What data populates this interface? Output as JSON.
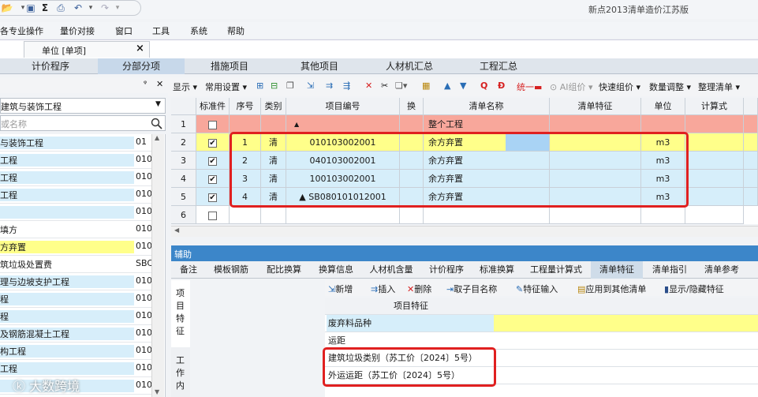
{
  "app": {
    "title": "新点2013清单造价江苏版"
  },
  "menu": [
    "各专业操作",
    "量价对接",
    "窗口",
    "工具",
    "系统",
    "帮助"
  ],
  "doc_tab": {
    "label": "单位 [单项]",
    "close": "×"
  },
  "ribbon_tabs": [
    {
      "label": "计价程序",
      "active": false
    },
    {
      "label": "分部分项",
      "active": true
    },
    {
      "label": "措施项目",
      "active": false
    },
    {
      "label": "其他项目",
      "active": false
    },
    {
      "label": "人材机汇总",
      "active": false
    },
    {
      "label": "工程汇总",
      "active": false
    }
  ],
  "sidebar": {
    "pin": "ᵠ",
    "close": "✕",
    "combo": "建筑与装饰工程",
    "search_placeholder": "或名称",
    "items": [
      {
        "name": "与装饰工程",
        "code": "01",
        "style": "blue"
      },
      {
        "name": "工程",
        "code": "010",
        "style": "blue"
      },
      {
        "name": "工程",
        "code": "010",
        "style": "blue"
      },
      {
        "name": "工程",
        "code": "010",
        "style": "blue"
      },
      {
        "name": "",
        "code": "010",
        "style": "blue"
      },
      {
        "name": "填方",
        "code": "010",
        "style": "plain"
      },
      {
        "name": "方弃置",
        "code": "010",
        "style": "yel"
      },
      {
        "name": "筑垃圾处置费",
        "code": "SBC",
        "style": "plain"
      },
      {
        "name": "理与边坡支护工程",
        "code": "010",
        "style": "blue"
      },
      {
        "name": "程",
        "code": "010",
        "style": "blue"
      },
      {
        "name": "程",
        "code": "010",
        "style": "blue"
      },
      {
        "name": "及钢筋混凝土工程",
        "code": "010",
        "style": "blue"
      },
      {
        "name": "构工程",
        "code": "010",
        "style": "blue"
      },
      {
        "name": "工程",
        "code": "010",
        "style": "blue"
      },
      {
        "name": "",
        "code": "010",
        "style": "blue"
      }
    ]
  },
  "toolbar": [
    "显示",
    "常用设置",
    "统一",
    "AI组价",
    "快速组价",
    "数量调整",
    "整理清单"
  ],
  "grid": {
    "headers": [
      "",
      "标准件",
      "序号",
      "类别",
      "项目编号",
      "换",
      "清单名称",
      "清单特征",
      "单位",
      "计算式"
    ],
    "rows": [
      {
        "rn": "1",
        "checked": false,
        "seq": "",
        "cat": "",
        "code": "▲",
        "name": "整个工程",
        "unit": "",
        "style": "salmon"
      },
      {
        "rn": "2",
        "checked": true,
        "seq": "1",
        "cat": "清",
        "code": "010103002001",
        "name": "余方弃置",
        "unit": "m3",
        "style": "yellow"
      },
      {
        "rn": "3",
        "checked": true,
        "seq": "2",
        "cat": "清",
        "code": "040103002001",
        "name": "余方弃置",
        "unit": "m3",
        "style": "blue"
      },
      {
        "rn": "4",
        "checked": true,
        "seq": "3",
        "cat": "清",
        "code": "100103002001",
        "name": "余方弃置",
        "unit": "m3",
        "style": "blue"
      },
      {
        "rn": "5",
        "checked": true,
        "seq": "4",
        "cat": "清",
        "code": "▲ SB080101012001",
        "name": "余方弃置",
        "unit": "m3",
        "style": "blue"
      },
      {
        "rn": "6",
        "checked": false,
        "seq": "",
        "cat": "",
        "code": "",
        "name": "",
        "unit": "",
        "style": "white"
      }
    ]
  },
  "assist": {
    "title": "辅助"
  },
  "assist_tabs": [
    {
      "label": "备注",
      "active": false
    },
    {
      "label": "模板钢筋",
      "active": false
    },
    {
      "label": "配比换算",
      "active": false
    },
    {
      "label": "换算信息",
      "active": false
    },
    {
      "label": "人材机含量",
      "active": false
    },
    {
      "label": "计价程序",
      "active": false
    },
    {
      "label": "标准换算",
      "active": false
    },
    {
      "label": "工程量计算式",
      "active": false
    },
    {
      "label": "清单特征",
      "active": true
    },
    {
      "label": "清单指引",
      "active": false
    },
    {
      "label": "清单参考",
      "active": false
    }
  ],
  "side_vertical": {
    "top": [
      "项",
      "目",
      "特",
      "征"
    ],
    "bottom": [
      "工",
      "作",
      "内"
    ]
  },
  "feature_toolbar": [
    "新增",
    "插入",
    "删除",
    "取子目名称",
    "特征输入",
    "应用到其他清单",
    "显示/隐藏特征"
  ],
  "feature_grid": {
    "header": "项目特征",
    "rows": [
      {
        "name": "废弃料品种",
        "style": "blue"
      },
      {
        "name": "运距",
        "style": "white"
      },
      {
        "name": "建筑垃圾类别（苏工价〔2024〕5号）",
        "style": "white"
      },
      {
        "name": "外运运距（苏工价〔2024〕5号）",
        "style": "white"
      }
    ]
  },
  "watermark": "大数跨境",
  "colors": {
    "accent": "#3c86c9",
    "highlight_yellow": "#ffff8a",
    "row_blue": "#d6eefa",
    "row_salmon": "#f8a79b",
    "red_box": "#e02020"
  }
}
